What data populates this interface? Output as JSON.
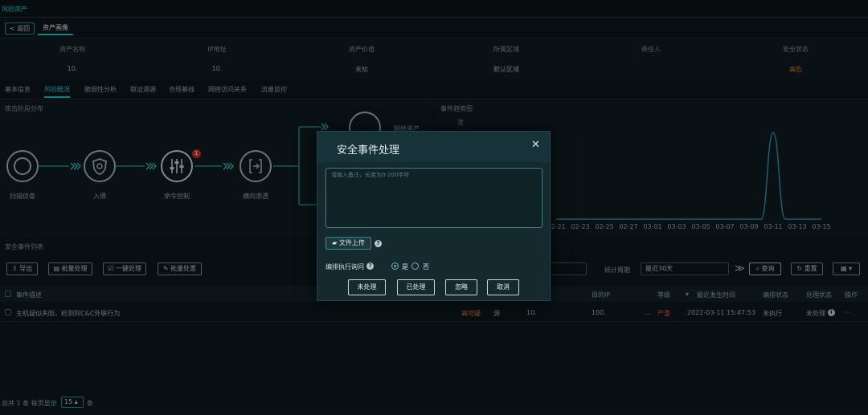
{
  "topbar": {
    "title": "风险资产"
  },
  "subbar": {
    "back_label": "< 返回",
    "asset_tab_label": "资产画像"
  },
  "asset_info": {
    "headers": [
      "资产名称",
      "IP地址",
      "资产价值",
      "所属区域",
      "责任人",
      "安全状态"
    ],
    "values": [
      "10.",
      "10.",
      "未知",
      "默认区域",
      "",
      "高危"
    ]
  },
  "tabs": [
    "基本信息",
    "风险概况",
    "脆弱性分析",
    "取证溯源",
    "合规基线",
    "网络访问关系",
    "流量监控"
  ],
  "active_tab": "风险概况",
  "attack_panel": {
    "title": "攻击阶段分布",
    "stages": [
      "扫描侦查",
      "入侵",
      "命令控制",
      "横向渗透"
    ],
    "badge_count": "1",
    "partial_label": "网络黑产"
  },
  "trend_panel": {
    "title": "事件趋势图",
    "ylabel": "次"
  },
  "chart_data": {
    "type": "line",
    "title": "事件趋势图",
    "xlabel": "",
    "ylabel": "次",
    "x_tick_labels": [
      "02-21",
      "02-23",
      "02-25",
      "02-27",
      "03-01",
      "03-03",
      "03-05",
      "03-07",
      "03-09",
      "03-11",
      "03-13",
      "03-15"
    ],
    "series": [
      {
        "x": [
          "02-21",
          "02-23",
          "02-25",
          "02-27",
          "03-01",
          "03-03",
          "03-05",
          "03-07",
          "03-09",
          "03-10",
          "03-11",
          "03-12",
          "03-13",
          "03-15"
        ],
        "values": [
          0,
          0,
          0,
          0,
          0,
          0,
          0,
          0,
          0,
          0,
          1,
          0,
          0,
          0
        ]
      }
    ],
    "color": "#2a8fb0"
  },
  "event_list": {
    "title": "安全事件列表",
    "toolbar": [
      "导出",
      "批量处理",
      "一键处理",
      "批量处置"
    ],
    "period_label": "统计周期",
    "period_value": "最近30天",
    "search_label": "查询",
    "reset_label": "重置",
    "columns": [
      "事件描述",
      "目的IP",
      "等级",
      "最近发生时间",
      "编排状态",
      "处理状态",
      "操作"
    ],
    "rows": [
      {
        "description": "主机疑似失陷，检测到C&C外联行为",
        "suspicion": "高可疑",
        "source_flag": "源",
        "ip": "10.",
        "dest_ip": "100.",
        "dest_ip_suffix": "...",
        "level": "严重",
        "time": "2022-03-11 15:47:53",
        "orch_status": "未执行",
        "handle_status": "未处理",
        "more": "···"
      }
    ],
    "footer": {
      "summary": "总共 1 条  每页显示",
      "page_size": "15",
      "unit": "条"
    }
  },
  "modal": {
    "title": "安全事件处理",
    "close": "✕",
    "placeholder": "请输入备注，长度为0-200字符",
    "upload_label": "文件上传",
    "ask_label": "编排执行询问",
    "yes": "是",
    "no": "否",
    "buttons": [
      "未处理",
      "已处理",
      "忽略",
      "取消"
    ]
  },
  "colors": {
    "accent": "#1ec8c8",
    "danger": "#d5792c",
    "severe": "#d9534f",
    "background": "#0d1a1f"
  },
  "icons": [
    "target-icon",
    "shield-icon",
    "sliders-icon",
    "lateral-move-icon",
    "folder-icon",
    "help-icon",
    "export-icon",
    "batch-icon",
    "one-click-icon",
    "wrench-icon",
    "search-icon",
    "refresh-icon",
    "grid-icon"
  ]
}
